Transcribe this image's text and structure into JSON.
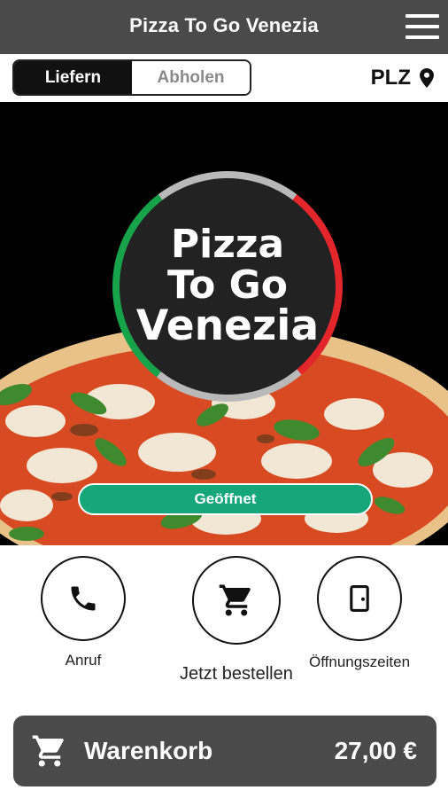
{
  "header": {
    "title": "Pizza To Go Venezia",
    "menu_icon": "hamburger-menu-icon"
  },
  "mode_toggle": {
    "delivery_label": "Liefern",
    "pickup_label": "Abholen",
    "selected": "Liefern"
  },
  "postcode": {
    "label": "PLZ",
    "icon": "location-pin-icon"
  },
  "hero": {
    "logo_lines": [
      "Pizza",
      "To Go",
      "Venezia"
    ],
    "status_label": "Geöffnet",
    "status_color": "#15a77a",
    "ring_colors": {
      "green": "#17a34a",
      "white": "#b9b9b9",
      "red": "#e3262b"
    }
  },
  "actions": [
    {
      "label": "Anruf",
      "icon": "phone-icon"
    },
    {
      "label": "Jetzt bestellen",
      "icon": "shopping-cart-icon"
    },
    {
      "label": "Öffnungszeiten",
      "icon": "door-icon"
    }
  ],
  "cart": {
    "label": "Warenkorb",
    "total": "27,00 €",
    "icon": "shopping-cart-icon"
  },
  "colors": {
    "bar_gray": "#4a4a4a",
    "accent_green": "#15a77a"
  }
}
